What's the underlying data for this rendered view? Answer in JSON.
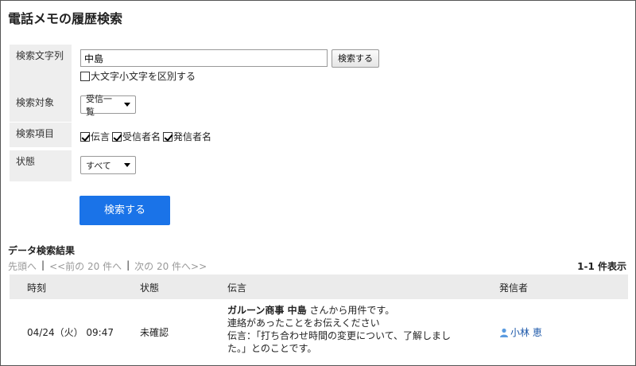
{
  "page": {
    "title": "電話メモの履歴検索"
  },
  "form": {
    "labels": {
      "search_text": "検索文字列",
      "target": "検索対象",
      "fields": "検索項目",
      "status": "状態"
    },
    "search_value": "中島",
    "search_button": "検索する",
    "case_checkbox": {
      "label": "大文字小文字を区別する",
      "checked": false
    },
    "target_select": "受信一覧",
    "field_checkboxes": [
      {
        "label": "伝言",
        "checked": true
      },
      {
        "label": "受信者名",
        "checked": true
      },
      {
        "label": "発信者名",
        "checked": true
      }
    ],
    "status_select": "すべて",
    "submit_button": "検索する"
  },
  "results": {
    "title": "データ検索結果",
    "pager": {
      "first": "先頭へ",
      "prev": "<<前の 20 件へ",
      "next": "次の 20 件へ>>",
      "sep": "|"
    },
    "count": "1-1 件表示",
    "headers": {
      "time": "時刻",
      "status": "状態",
      "message": "伝言",
      "from": "発信者"
    },
    "rows": [
      {
        "time": "04/24（火） 09:47",
        "status": "未確認",
        "message_company": "ガルーン商事 中島",
        "message_line1_rest": " さんから用件です。",
        "message_line2": "連絡があったことをお伝えください",
        "message_line3": "伝言：「打ち合わせ時間の変更について、了解しまし",
        "message_line4": "た。」とのことです。",
        "from": "小林 恵"
      }
    ]
  },
  "colors": {
    "primary_button": "#1a73e8",
    "label_bg": "#eeeeee",
    "link": "#1a56a8"
  }
}
